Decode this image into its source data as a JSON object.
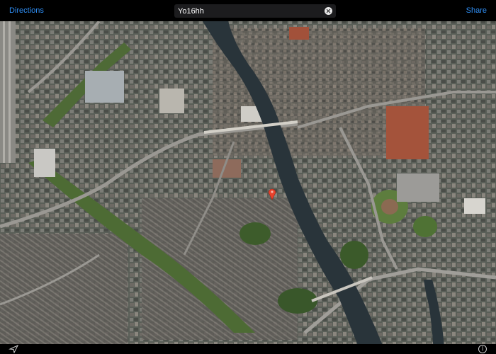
{
  "toolbar": {
    "directions_label": "Directions",
    "share_label": "Share"
  },
  "search": {
    "value": "Yo16hh",
    "clear_icon": "clear-icon"
  },
  "map": {
    "view": "satellite",
    "pin_color": "#e8412c",
    "river_color": "#29343a",
    "icons": [
      "location-arrow-icon",
      "info-icon"
    ]
  },
  "bottom": {
    "info_glyph": "i"
  }
}
